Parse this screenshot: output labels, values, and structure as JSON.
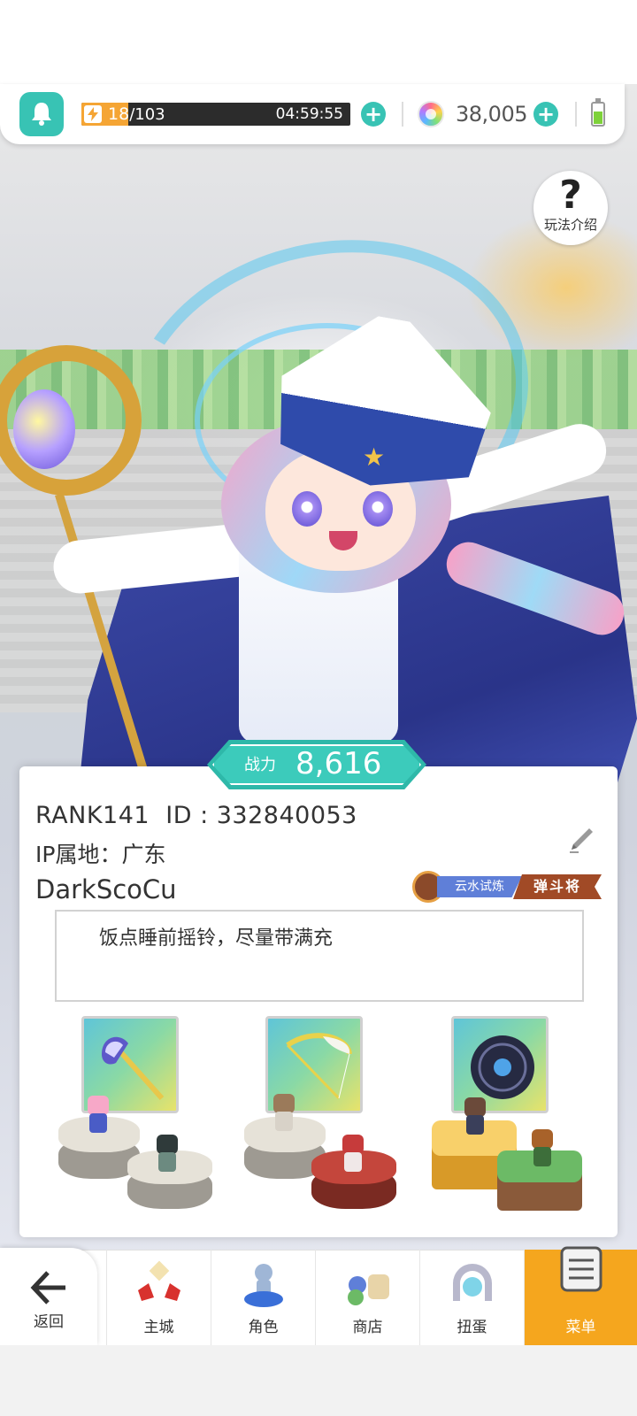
{
  "topbar": {
    "stamina_current": "18",
    "stamina_max": "/103",
    "stamina_fraction": 0.175,
    "timer": "04:59:55",
    "gems": "38,005",
    "plus": "+"
  },
  "help": {
    "label": "玩法介绍",
    "icon": "?"
  },
  "profile": {
    "power_label": "战力",
    "power_value": "8,616",
    "rank_line": "RANK141  ID : 332840053",
    "ip_line": "IP属地：广东",
    "name": "DarkScoCu",
    "title_left": "云水试炼",
    "title_right": "弹斗将",
    "bio": "饭点睡前摇铃，尽量带满充"
  },
  "team": [
    {
      "weapon": "axe-icon"
    },
    {
      "weapon": "bow-icon"
    },
    {
      "weapon": "orb-icon"
    }
  ],
  "nav": {
    "back": "返回",
    "items": [
      {
        "label": "主城",
        "icon": "castle-icon"
      },
      {
        "label": "角色",
        "icon": "character-icon"
      },
      {
        "label": "商店",
        "icon": "shop-icon"
      },
      {
        "label": "扭蛋",
        "icon": "gacha-icon"
      },
      {
        "label": "菜单",
        "icon": "menu-icon"
      }
    ]
  },
  "colors": {
    "teal": "#38c3b4",
    "stamina_orange": "#f5a534",
    "nav_active": "#f5a61e"
  }
}
